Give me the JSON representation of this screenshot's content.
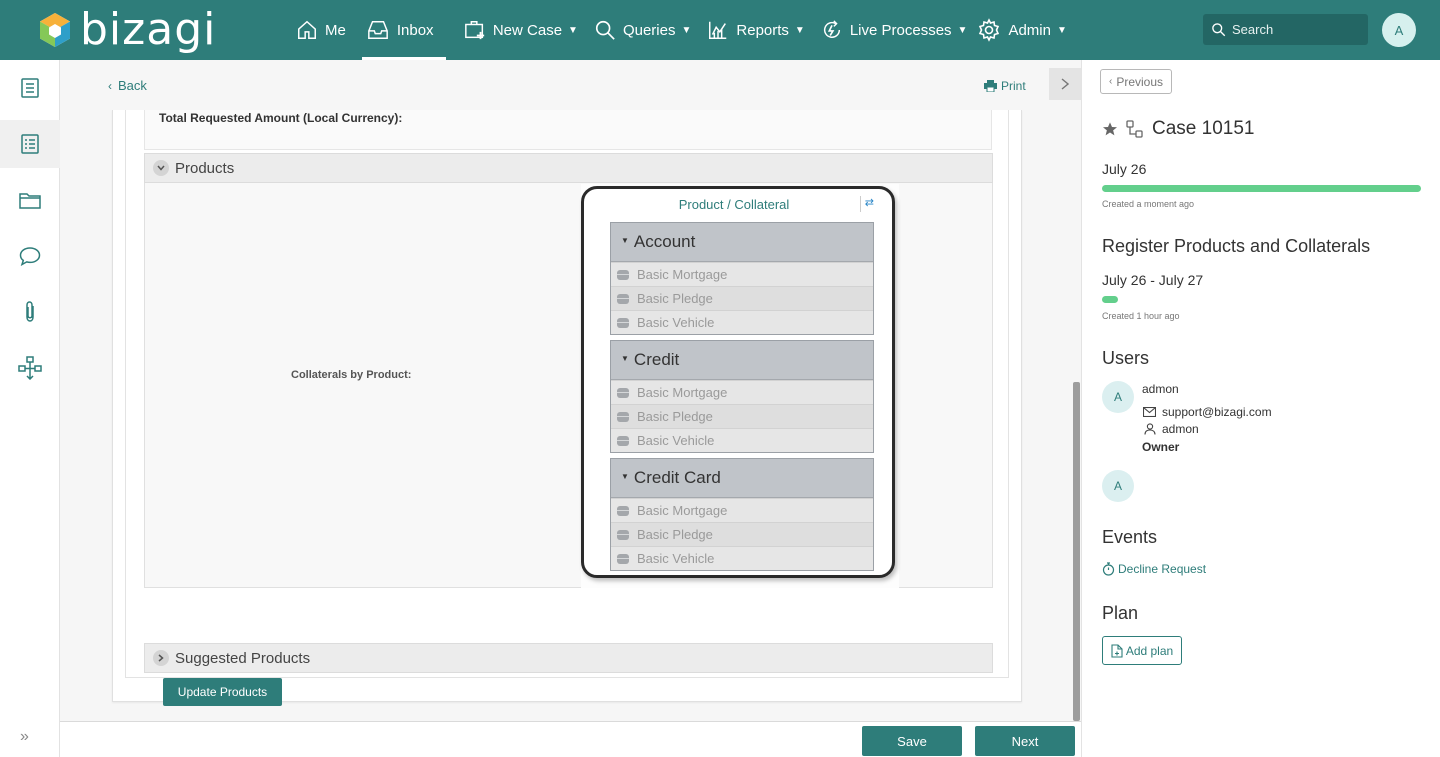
{
  "app": {
    "logo_text": "bizagi"
  },
  "nav": {
    "items": [
      {
        "label": "Me",
        "icon": "home-icon"
      },
      {
        "label": "Inbox",
        "icon": "inbox-icon",
        "active": true
      },
      {
        "label": "New Case",
        "icon": "new-case-icon",
        "has_caret": true
      },
      {
        "label": "Queries",
        "icon": "search-icon",
        "has_caret": true
      },
      {
        "label": "Reports",
        "icon": "reports-icon",
        "has_caret": true
      },
      {
        "label": "Live Processes",
        "icon": "live-processes-icon",
        "has_caret": true
      },
      {
        "label": "Admin",
        "icon": "gear-icon",
        "has_caret": true
      }
    ],
    "search_placeholder": "Search",
    "user_initial": "A"
  },
  "sidebar": {
    "items": [
      "task-list-icon",
      "case-list-icon",
      "folder-icon",
      "comment-icon",
      "attachment-icon",
      "workflow-icon"
    ],
    "active_index": 1
  },
  "main": {
    "back_label": "Back",
    "print_label": "Print",
    "total_label": "Total Requested Amount (Local Currency):",
    "products_group": "Products",
    "collaterals_label": "Collaterals by Product:",
    "tree": {
      "title": "Product / Collateral",
      "groups": [
        {
          "name": "Account",
          "items": [
            "Basic Mortgage",
            "Basic Pledge",
            "Basic Vehicle"
          ]
        },
        {
          "name": "Credit",
          "items": [
            "Basic Mortgage",
            "Basic Pledge",
            "Basic Vehicle"
          ]
        },
        {
          "name": "Credit Card",
          "items": [
            "Basic Mortgage",
            "Basic Pledge",
            "Basic Vehicle"
          ]
        }
      ]
    },
    "suggested_group": "Suggested Products",
    "update_button": "Update Products"
  },
  "footer": {
    "save_label": "Save",
    "next_label": "Next"
  },
  "panel": {
    "previous_label": "Previous",
    "case_title": "Case 10151",
    "case_date": "July 26",
    "case_progress": 1.0,
    "case_created": "Created a moment ago",
    "task_title": "Register Products and Collaterals",
    "task_dates": "July 26 - July 27",
    "task_progress": 0.05,
    "task_created": "Created 1 hour ago",
    "users_heading": "Users",
    "user": {
      "initial": "A",
      "name": "admon",
      "email": "support@bizagi.com",
      "login": "admon",
      "role": "Owner"
    },
    "user2_initial": "A",
    "events_heading": "Events",
    "event_link": "Decline Request",
    "plan_heading": "Plan",
    "add_plan_label": "Add plan"
  },
  "colors": {
    "brand": "#2e7d7a",
    "progress": "#63cf8c"
  }
}
